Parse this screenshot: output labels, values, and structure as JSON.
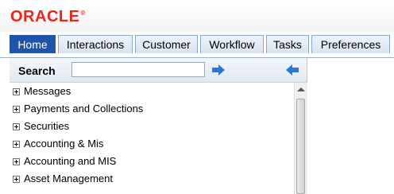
{
  "header": {
    "logo_text": "ORACLE",
    "logo_mark": "®"
  },
  "tabs": [
    {
      "label": "Home",
      "active": true
    },
    {
      "label": "Interactions",
      "active": false
    },
    {
      "label": "Customer",
      "active": false
    },
    {
      "label": "Workflow",
      "active": false
    },
    {
      "label": "Tasks",
      "active": false
    },
    {
      "label": "Preferences",
      "active": false
    }
  ],
  "search": {
    "label": "Search",
    "value": "",
    "go_icon": "right-arrow-icon",
    "collapse_icon": "left-arrow-icon"
  },
  "tree": {
    "items": [
      "Messages",
      "Payments and Collections",
      "Securities",
      "Accounting & Mis",
      "Accounting and MIS",
      "Asset Management"
    ]
  },
  "colors": {
    "brand": "#e8271f",
    "active_tab": "#1f54a8",
    "arrow": "#2a78d6"
  }
}
